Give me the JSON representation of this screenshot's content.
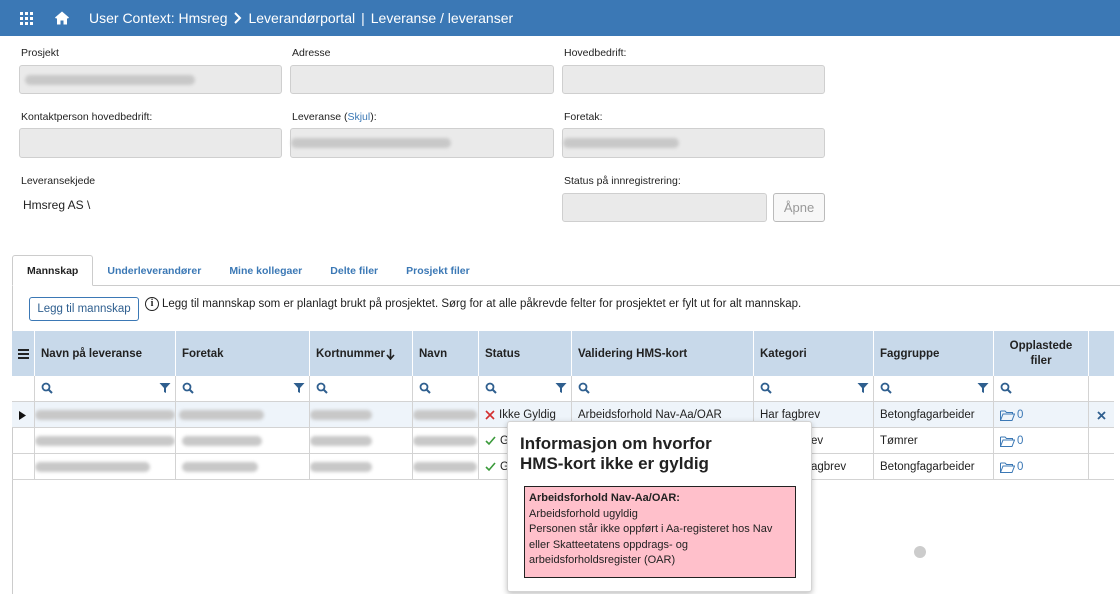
{
  "nav": {
    "context": "User Context: Hmsreg",
    "portal": "Leverandørportal",
    "page": "Leveranse / leveranser"
  },
  "form": {
    "prosjekt_label": "Prosjekt",
    "adresse_label": "Adresse",
    "hovedbedrift_label": "Hovedbedrift:",
    "kontaktperson_label": "Kontaktperson hovedbedrift:",
    "leveranse_label": "Leveranse (",
    "skjul_link": "Skjul",
    "leveranse_label_end": "):",
    "foretak_label": "Foretak:",
    "leveransekjede_label": "Leveransekjede",
    "leveransekjede_value": "Hmsreg AS \\",
    "status_label": "Status på innregistrering:",
    "open_button": "Åpne"
  },
  "tabs": [
    "Mannskap",
    "Underleverandører",
    "Mine kollegaer",
    "Delte filer",
    "Prosjekt filer"
  ],
  "toolbar": {
    "add_button": "Legg til mannskap",
    "info_icon": "i",
    "info_text": "Legg til mannskap som er planlagt brukt på prosjektet. Sørg for at alle påkrevde felter for prosjektet er fylt ut for alt mannskap."
  },
  "grid": {
    "columns": {
      "navn_leveranse": "Navn på leveranse",
      "foretak": "Foretak",
      "kortnummer": "Kortnummer",
      "navn": "Navn",
      "status": "Status",
      "validering": "Validering HMS-kort",
      "kategori": "Kategori",
      "faggruppe": "Faggruppe",
      "opplastede_1": "Opplastede",
      "opplastede_2": "filer"
    },
    "rows": [
      {
        "status": "Ikke Gyldig",
        "validering": "Arbeidsforhold Nav-Aa/OAR",
        "kategori": "Har fagbrev",
        "faggruppe": "Betongfagarbeider",
        "files": "0"
      },
      {
        "status": "G",
        "validering": "",
        "kategori": "ev",
        "faggruppe": "Tømrer",
        "files": "0"
      },
      {
        "status": "G",
        "validering": "",
        "kategori": "agbrev",
        "faggruppe": "Betongfagarbeider",
        "files": "0"
      }
    ]
  },
  "tooltip": {
    "title_line1": "Informasjon om hvorfor",
    "title_line2": "HMS-kort ikke er gyldig",
    "box_title": "Arbeidsforhold Nav-Aa/OAR:",
    "line1": "Arbeidsforhold ugyldig",
    "line2": "Personen står ikke oppført i Aa-registeret hos Nav",
    "line3": "eller Skatteetatens oppdrags- og",
    "line4": "arbeidsforholdsregister (OAR)"
  },
  "colors": {
    "topbar": "#3b78b5",
    "header": "#c8d9ea",
    "error_box": "#ffc0cb",
    "invalid": "#d32f2f",
    "valid": "#3a9a3a"
  }
}
